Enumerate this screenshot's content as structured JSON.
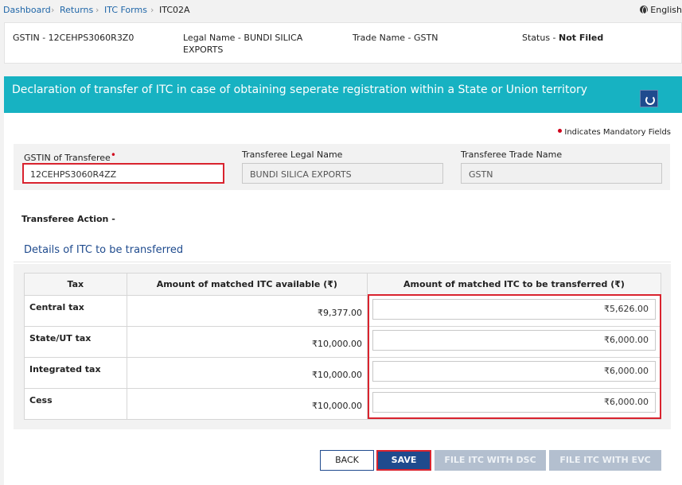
{
  "breadcrumb": {
    "dashboard": "Dashboard",
    "returns": "Returns",
    "itc_forms": "ITC Forms",
    "current": "ITC02A",
    "separator": "›"
  },
  "language": "English",
  "info": {
    "gstin": "GSTIN - 12CEHPS3060R3Z0",
    "legal_name_line1": "Legal Name - BUNDI SILICA",
    "legal_name_line2": "EXPORTS",
    "trade_name": "Trade Name - GSTN",
    "status_label": "Status - ",
    "status_value": "Not Filed"
  },
  "banner": {
    "title": "Declaration of transfer of ITC in case of obtaining seperate registration within a State or Union territory"
  },
  "mandatory_note": "Indicates Mandatory Fields",
  "fields": {
    "gstin_label": "GSTIN of Transferee",
    "gstin_value": "12CEHPS3060R4ZZ",
    "legal_name_label": "Transferee Legal Name",
    "legal_name_value": "BUNDI SILICA EXPORTS",
    "trade_name_label": "Transferee Trade Name",
    "trade_name_value": "GSTN"
  },
  "transferee_action_label": "Transferee Action -",
  "section_title": "Details of ITC to be transferred",
  "table": {
    "headers": [
      "Tax",
      "Amount of matched ITC available (₹)",
      "Amount of matched ITC to be transferred (₹)"
    ],
    "rows": [
      {
        "tax": "Central tax",
        "available": "₹9,377.00",
        "transfer": "₹5,626.00"
      },
      {
        "tax": "State/UT tax",
        "available": "₹10,000.00",
        "transfer": "₹6,000.00"
      },
      {
        "tax": "Integrated tax",
        "available": "₹10,000.00",
        "transfer": "₹6,000.00"
      },
      {
        "tax": "Cess",
        "available": "₹10,000.00",
        "transfer": "₹6,000.00"
      }
    ]
  },
  "buttons": {
    "back": "BACK",
    "save": "SAVE",
    "file_dsc": "FILE ITC WITH DSC",
    "file_evc": "FILE ITC WITH EVC"
  },
  "colors": {
    "banner": "#17b2c2",
    "primary": "#1f4b8e",
    "highlight": "#d9232e",
    "link": "#1f66a8"
  }
}
